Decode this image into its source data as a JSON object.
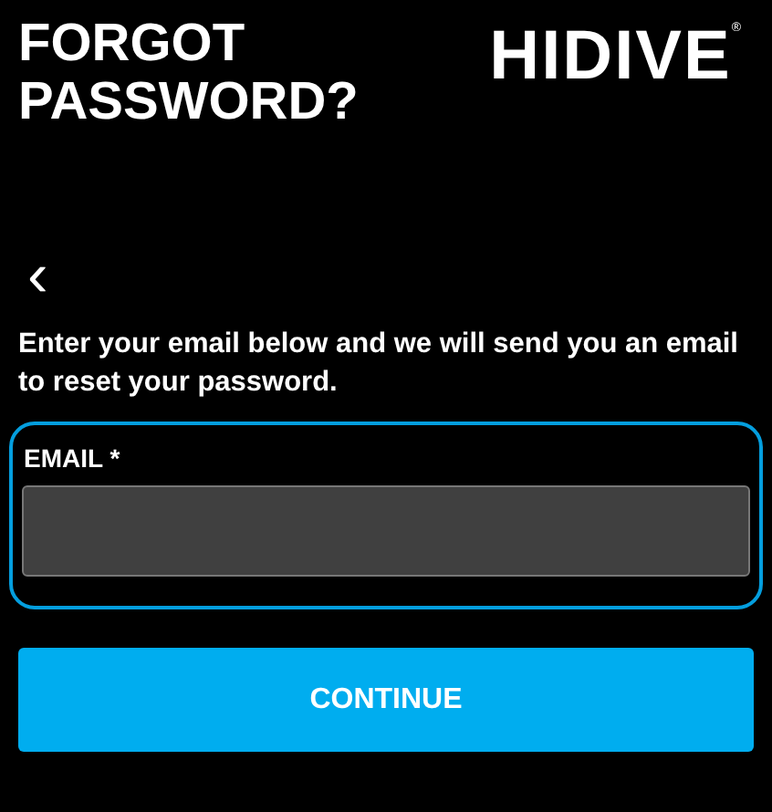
{
  "title": "FORGOT PASSWORD?",
  "logo": {
    "text": "HIDIVE",
    "mark": "®"
  },
  "back_button": {
    "label": "‹"
  },
  "instructions": "Enter your email below and we will send you an email to reset your password.",
  "email_field": {
    "label": "EMAIL *",
    "focused": true
  },
  "submit_button": {
    "label": "CONTINUE"
  }
}
